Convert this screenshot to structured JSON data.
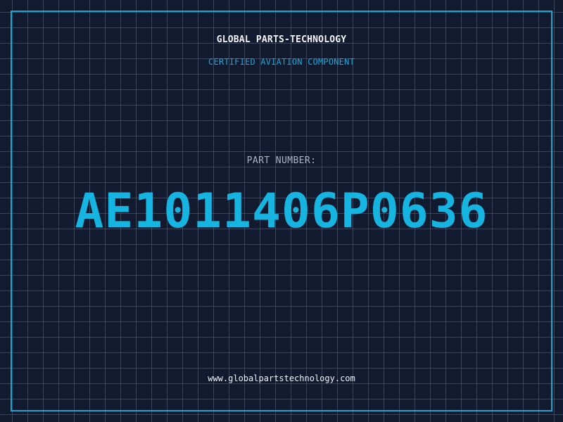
{
  "header": {
    "company_name": "GLOBAL PARTS-TECHNOLOGY",
    "subtitle": "CERTIFIED AVIATION COMPONENT"
  },
  "main": {
    "label": "PART NUMBER:",
    "part_number": "AE1011406P0636"
  },
  "footer": {
    "website": "www.globalpartstechnology.com"
  },
  "colors": {
    "background": "#111a2e",
    "grid": "#2a7896",
    "accent": "#16b4e0",
    "frame": "#1fa3cf"
  }
}
